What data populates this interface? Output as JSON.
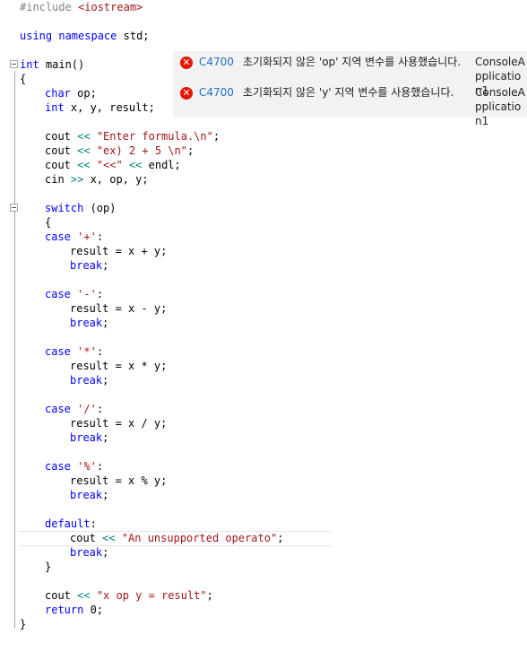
{
  "errors": [
    {
      "code": "C4700",
      "message": "초기화되지 않은 'op' 지역 변수를 사용했습니다.",
      "project": "ConsoleApplication1"
    },
    {
      "code": "C4700",
      "message": "초기화되지 않은 'y' 지역 변수를 사용했습니다.",
      "project": "ConsoleApplication1"
    }
  ],
  "code": {
    "l1_pp": "#include ",
    "l1_inc": "<iostream>",
    "l2_kw1": "using",
    "l2_kw2": "namespace",
    "l2_rest": " std;",
    "l3_kw": "int",
    "l3_rest": " main()",
    "l4": "{",
    "l5_kw": "char",
    "l5_rest": " op;",
    "l6_kw": "int",
    "l6_rest": " x, y, result;",
    "l7_a": "cout ",
    "l7_op": "<<",
    "l7_str": "\"Enter formula.\\n\"",
    "l7_end": ";",
    "l8_a": "cout ",
    "l8_op": "<<",
    "l8_str": "\"ex) 2 + 5 \\n\"",
    "l8_end": ";",
    "l9_a": "cout ",
    "l9_op1": "<<",
    "l9_str": "\"<<\"",
    "l9_op2": "<<",
    "l9_end": " endl;",
    "l10_a": "cin ",
    "l10_op": ">>",
    "l10_end": " x, op, y;",
    "l11_kw": "switch",
    "l11_rest": " (op)",
    "l12": "{",
    "case_kw": "case",
    "c1_str": "'+'",
    "c1_body": "result = x + y;",
    "c2_str": "'-'",
    "c2_body": "result = x - y;",
    "c3_str": "'*'",
    "c3_body": "result = x * y;",
    "c4_str": "'/'",
    "c4_body": "result = x / y;",
    "c5_str": "'%'",
    "c5_body": "result = x % y;",
    "colon": ":",
    "break_kw": "break",
    "semi": ";",
    "default_kw": "default",
    "d_a": "cout ",
    "d_op": "<<",
    "d_str": "\"An unsupported operato\"",
    "d_end": ";",
    "close_switch": "}",
    "out_a": "cout ",
    "out_op": "<<",
    "out_str": "\"x op y = result\"",
    "out_end": ";",
    "ret_kw": "return",
    "ret_rest": " 0;",
    "close_main": "}"
  }
}
